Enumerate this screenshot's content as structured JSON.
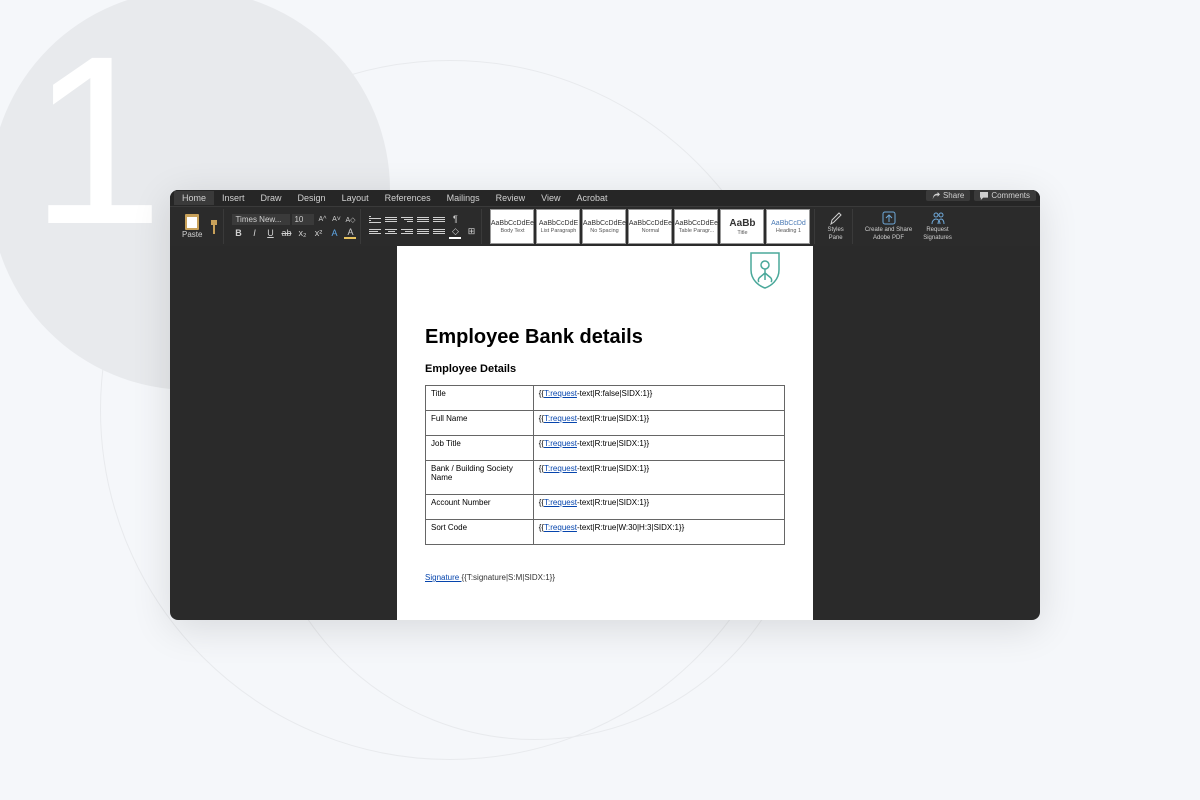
{
  "watermark": {
    "number": "1"
  },
  "ribbon": {
    "tabs": [
      "Home",
      "Insert",
      "Draw",
      "Design",
      "Layout",
      "References",
      "Mailings",
      "Review",
      "View",
      "Acrobat"
    ],
    "selected_tab": "Home",
    "share_label": "Share",
    "comments_label": "Comments"
  },
  "toolbar": {
    "paste_label": "Paste",
    "font_name": "Times New...",
    "font_size": "10",
    "styles": [
      {
        "preview": "AaBbCcDdEe",
        "label": "Body Text"
      },
      {
        "preview": "AaBbCcDdE",
        "label": "List Paragraph"
      },
      {
        "preview": "AaBbCcDdEe",
        "label": "No Spacing"
      },
      {
        "preview": "AaBbCcDdEe",
        "label": "Normal"
      },
      {
        "preview": "AaBbCcDdEe",
        "label": "Table Paragr..."
      },
      {
        "preview": "AaBb",
        "label": "Title"
      },
      {
        "preview": "AaBbCcDd",
        "label": "Heading 1"
      }
    ],
    "styles_pane": "Styles\nPane",
    "adobe_create": "Create and Share\nAdobe PDF",
    "adobe_request": "Request\nSignatures"
  },
  "document": {
    "title": "Employee Bank details",
    "section_heading": "Employee Details",
    "rows": [
      {
        "label": "Title",
        "token_link": "T:request",
        "token_rest": "-text|R:false|SIDX:1}}"
      },
      {
        "label": "Full Name",
        "token_link": "T:request",
        "token_rest": "-text|R:true|SIDX:1}}"
      },
      {
        "label": "Job Title",
        "token_link": "T:request",
        "token_rest": "-text|R:true|SIDX:1}}"
      },
      {
        "label": "Bank / Building Society Name",
        "token_link": "T:request",
        "token_rest": "-text|R:true|SIDX:1}}"
      },
      {
        "label": "Account Number",
        "token_link": "T:request",
        "token_rest": "-text|R:true|SIDX:1}}"
      },
      {
        "label": "Sort Code",
        "token_link": "T:request",
        "token_rest": "-text|R:true|W:30|H:3|SIDX:1}}"
      }
    ],
    "signature_label": "Signature ",
    "signature_token": "{{T:signature|S:M|SIDX:1}}"
  }
}
